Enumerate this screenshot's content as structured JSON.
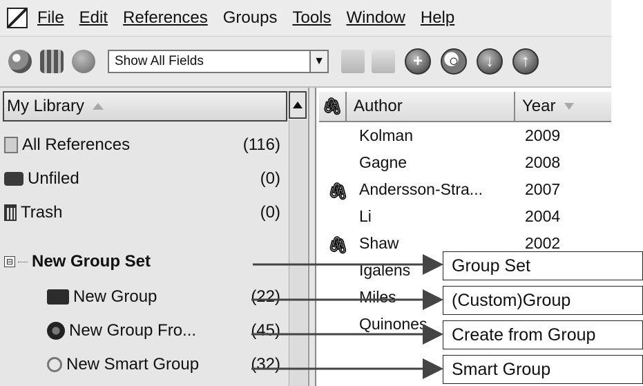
{
  "menu": [
    "File",
    "Edit",
    "References",
    "Groups",
    "Tools",
    "Window",
    "Help"
  ],
  "toolbar": {
    "field_selector_value": "Show All Fields",
    "icons": [
      "online-search-icon",
      "local-library-icon",
      "integrated-library-icon",
      "copy-formatted-icon",
      "insert-citation-icon",
      "new-reference-icon",
      "search-icon",
      "download-icon",
      "upload-icon"
    ]
  },
  "library": {
    "header": "My Library",
    "items": [
      {
        "label": "All References",
        "count": "(116)",
        "icon": "references-icon"
      },
      {
        "label": "Unfiled",
        "count": "(0)",
        "icon": "unfiled-icon"
      },
      {
        "label": "Trash",
        "count": "(0)",
        "icon": "trash-icon"
      }
    ],
    "group_set": {
      "label": "New Group Set",
      "expander": "⊟",
      "groups": [
        {
          "label": "New Group",
          "count": "(22)",
          "icon": "folder-icon"
        },
        {
          "label": "New Group Fro...",
          "count": "(45)",
          "icon": "group-from-groups-icon"
        },
        {
          "label": "New Smart Group",
          "count": "(32)",
          "icon": "smart-group-icon"
        }
      ]
    }
  },
  "reference_list": {
    "columns": {
      "attachment": "",
      "author": "Author",
      "year": "Year"
    },
    "rows": [
      {
        "attachment": false,
        "author": "Kolman",
        "year": "2009"
      },
      {
        "attachment": false,
        "author": "Gagne",
        "year": "2008"
      },
      {
        "attachment": true,
        "author": "Andersson-Stra...",
        "year": "2007"
      },
      {
        "attachment": false,
        "author": "Li",
        "year": "2004"
      },
      {
        "attachment": true,
        "author": "Shaw",
        "year": "2002"
      },
      {
        "attachment": false,
        "author": "Igalens",
        "year": ""
      },
      {
        "attachment": false,
        "author": "Miles",
        "year": ""
      },
      {
        "attachment": false,
        "author": "Quinones",
        "year": ""
      }
    ],
    "attachment_glyph": "🖇"
  },
  "annotations": [
    {
      "label": "Group Set"
    },
    {
      "label": "(Custom)Group"
    },
    {
      "label": "Create from Group"
    },
    {
      "label": "Smart Group"
    }
  ]
}
